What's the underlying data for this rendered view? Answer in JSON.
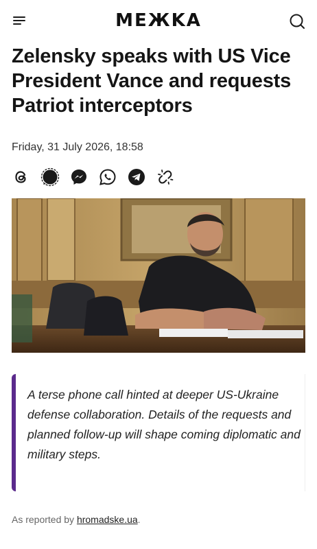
{
  "header": {
    "logo": "MEЖKA",
    "menu_icon": "menu-icon",
    "search_icon": "search-icon"
  },
  "article": {
    "title": "Zelensky speaks with US Vice President Vance and requests Patriot interceptors",
    "date": "Friday, 31 July 2026, 18:58",
    "share_icons": [
      "threads-icon",
      "signal-icon",
      "messenger-icon",
      "whatsapp-icon",
      "telegram-icon",
      "copy-link-icon"
    ],
    "quote": "A terse phone call hinted at deeper US-Ukraine defense collaboration. Details of the requests and planned follow-up will shape coming diplomatic and military steps.",
    "source_prefix": "As reported by ",
    "source_link": "hromadske.ua",
    "source_suffix": "."
  },
  "colors": {
    "accent": "#5b2a8c",
    "text": "#151515"
  }
}
